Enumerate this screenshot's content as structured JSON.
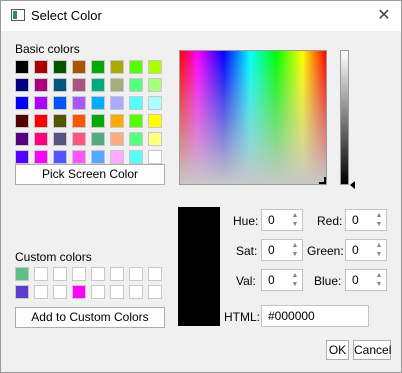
{
  "window": {
    "title": "Select Color"
  },
  "basic": {
    "label": "Basic colors",
    "swatches": [
      "#000000",
      "#aa0000",
      "#005500",
      "#aa5500",
      "#00aa00",
      "#aaaa00",
      "#55ff00",
      "#aaff00",
      "#000080",
      "#aa007f",
      "#00557f",
      "#aa557f",
      "#00aa7f",
      "#aaaa7f",
      "#55ff7f",
      "#aaff7f",
      "#0000ff",
      "#aa00ff",
      "#0055ff",
      "#aa55ff",
      "#00aaff",
      "#aaaaff",
      "#55ffff",
      "#aaffff",
      "#550000",
      "#ff0000",
      "#555500",
      "#ff5500",
      "#00aa00",
      "#ffaa00",
      "#55ff00",
      "#ffff00",
      "#550080",
      "#ff007f",
      "#55557f",
      "#ff557f",
      "#55aa7f",
      "#ffaa7f",
      "#55ff7f",
      "#ffff7f",
      "#5500ff",
      "#ff00ff",
      "#5555ff",
      "#ff55ff",
      "#55aaff",
      "#ffaaff",
      "#55ffff",
      "#ffffff"
    ]
  },
  "pick_button": "Pick Screen Color",
  "custom": {
    "label": "Custom colors",
    "swatches": [
      "#5fbe8a",
      "#ffffff",
      "#ffffff",
      "#ffffff",
      "#ffffff",
      "#ffffff",
      "#ffffff",
      "#ffffff",
      "#5b3ccc",
      "#ffffff",
      "#ffffff",
      "#ff00ff",
      "#ffffff",
      "#ffffff",
      "#ffffff",
      "#ffffff"
    ]
  },
  "add_button": "Add to Custom Colors",
  "fields": {
    "hue": {
      "label": "Hue:",
      "value": "0"
    },
    "sat": {
      "label": "Sat:",
      "value": "0"
    },
    "val": {
      "label": "Val:",
      "value": "0"
    },
    "red": {
      "label": "Red:",
      "value": "0"
    },
    "green": {
      "label": "Green:",
      "value": "0"
    },
    "blue": {
      "label": "Blue:",
      "value": "0"
    },
    "html": {
      "label": "HTML:",
      "value": "#000000"
    }
  },
  "current_color": "#000000",
  "ok_button": "OK",
  "cancel_button": "Cancel",
  "icons": {
    "close": "close-icon",
    "app": "color-dialog-icon",
    "spin_up": "chevron-up-icon",
    "spin_down": "chevron-down-icon"
  }
}
